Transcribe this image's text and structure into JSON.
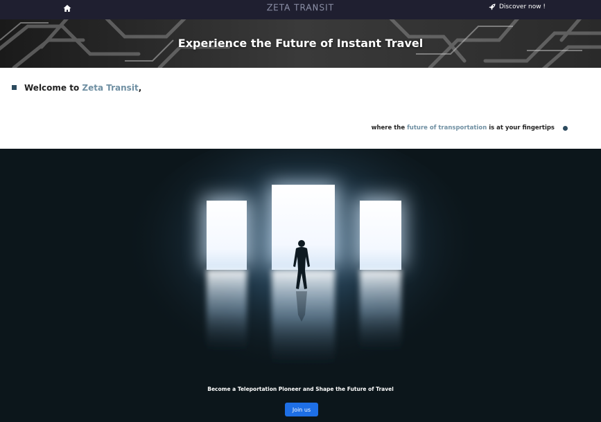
{
  "nav": {
    "home_icon": "home-icon",
    "logo": "ZETA TRANSIT",
    "discover_icon": "rocket-icon",
    "discover_label": "Discover now !"
  },
  "banner": {
    "title": "Experience the Future of Instant Travel"
  },
  "welcome": {
    "prefix": "Welcome to ",
    "brand": "Zeta Transit",
    "suffix": ",",
    "tag_prefix": "where the ",
    "tag_accent": "future of transportation",
    "tag_suffix": " is at your fingertips"
  },
  "hero": {
    "cta_text": "Become a Teleportation Pioneer and Shape the Future of Travel",
    "join_label": "Join us"
  },
  "colors": {
    "nav_bg": "#1f1f30",
    "accent": "#6f8fa2",
    "bullet": "#2c4a5e",
    "button": "#1e6fe6"
  }
}
